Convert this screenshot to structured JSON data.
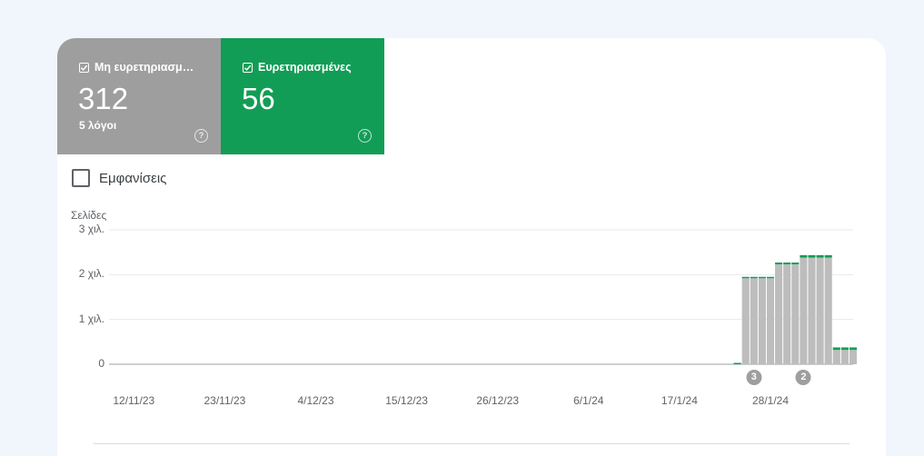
{
  "tiles": {
    "not_indexed": {
      "label": "Μη ευρετηριασμ…",
      "value": "312",
      "sub": "5 λόγοι",
      "color": "#9e9e9e",
      "help": "?"
    },
    "indexed": {
      "label": "Ευρετηριασμένες",
      "value": "56",
      "color": "#129d56",
      "help": "?"
    }
  },
  "impressions": {
    "label": "Εμφανίσεις",
    "checked": false
  },
  "chart_data": {
    "type": "bar",
    "ylabel": "Σελίδες",
    "ytick_labels": [
      "3 χιλ.",
      "2 χιλ.",
      "1 χιλ.",
      "0"
    ],
    "ylim": [
      0,
      3000
    ],
    "xtick_labels": [
      "12/11/23",
      "23/11/23",
      "4/12/23",
      "15/12/23",
      "26/12/23",
      "6/1/24",
      "17/1/24",
      "28/1/24"
    ],
    "x_range": [
      "9/11/23",
      "7/2/24"
    ],
    "series": [
      {
        "color": "#bdbdbd",
        "points": [
          {
            "x": "25/1/24",
            "y": 1920
          },
          {
            "x": "26/1/24",
            "y": 1920
          },
          {
            "x": "27/1/24",
            "y": 1920
          },
          {
            "x": "28/1/24",
            "y": 1920
          },
          {
            "x": "29/1/24",
            "y": 2230
          },
          {
            "x": "30/1/24",
            "y": 2230
          },
          {
            "x": "31/1/24",
            "y": 2230
          },
          {
            "x": "1/2/24",
            "y": 2380
          },
          {
            "x": "2/2/24",
            "y": 2380
          },
          {
            "x": "3/2/24",
            "y": 2380
          },
          {
            "x": "4/2/24",
            "y": 2380
          },
          {
            "x": "5/2/24",
            "y": 320
          },
          {
            "x": "6/2/24",
            "y": 320
          },
          {
            "x": "7/2/24",
            "y": 320
          }
        ]
      },
      {
        "color": "#129d56",
        "points": [
          {
            "x": "24/1/24",
            "y": 5
          },
          {
            "x": "25/1/24",
            "y": 30
          },
          {
            "x": "26/1/24",
            "y": 30
          },
          {
            "x": "27/1/24",
            "y": 30
          },
          {
            "x": "28/1/24",
            "y": 30
          },
          {
            "x": "29/1/24",
            "y": 40
          },
          {
            "x": "30/1/24",
            "y": 40
          },
          {
            "x": "31/1/24",
            "y": 40
          },
          {
            "x": "1/2/24",
            "y": 55
          },
          {
            "x": "2/2/24",
            "y": 55
          },
          {
            "x": "3/2/24",
            "y": 55
          },
          {
            "x": "4/2/24",
            "y": 55
          },
          {
            "x": "5/2/24",
            "y": 56
          },
          {
            "x": "6/2/24",
            "y": 56
          },
          {
            "x": "7/2/24",
            "y": 56
          }
        ]
      }
    ],
    "annotations": [
      {
        "x": "26/1/24",
        "label": "3"
      },
      {
        "x": "1/2/24",
        "label": "2"
      }
    ]
  }
}
